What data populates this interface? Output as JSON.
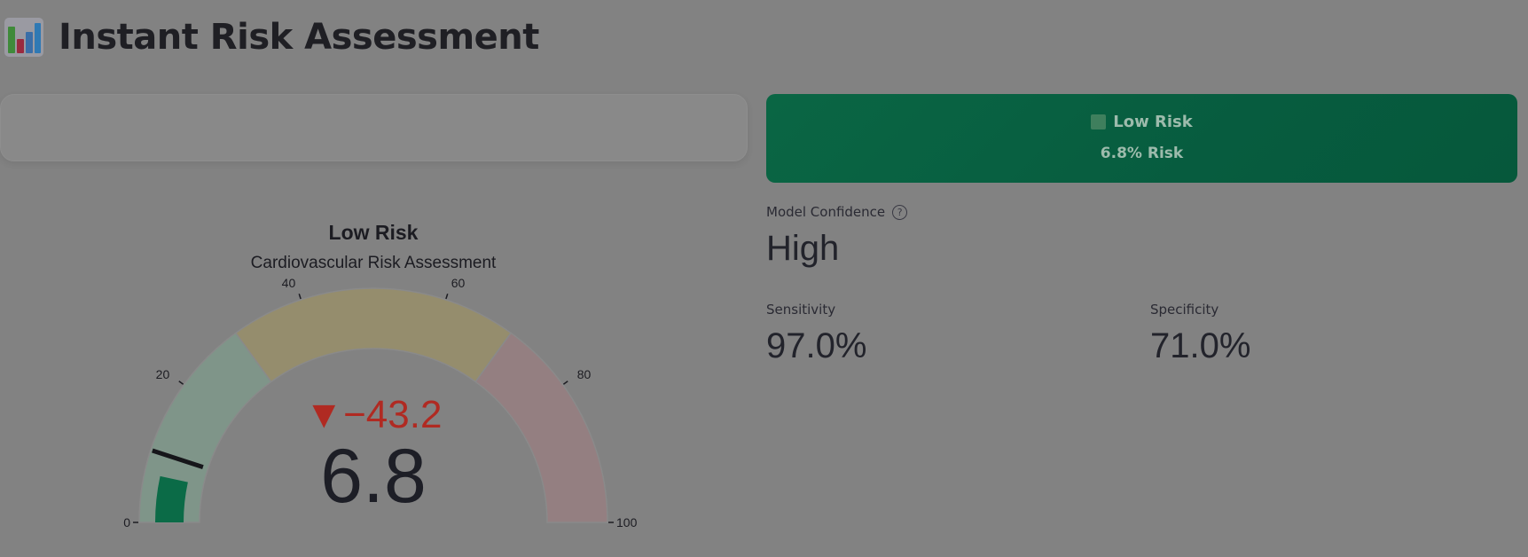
{
  "header": {
    "icon": "bar-chart-icon",
    "title": "Instant Risk Assessment"
  },
  "banner": {
    "icon": "green-square-icon",
    "label": "Low Risk",
    "risk_text": "6.8% Risk",
    "color": "#0a6644"
  },
  "metrics": {
    "confidence": {
      "label": "Model Confidence",
      "help_icon": "question-circle-icon",
      "value": "High"
    },
    "sensitivity": {
      "label": "Sensitivity",
      "value": "97.0%"
    },
    "specificity": {
      "label": "Specificity",
      "value": "71.0%"
    }
  },
  "gauge": {
    "title": "Low Risk",
    "subtitle": "Cardiovascular Risk Assessment",
    "value": 6.8,
    "value_text": "6.8",
    "delta_text": "▼−43.2",
    "delta_color": "#b02a22",
    "range": [
      0,
      100
    ],
    "tick_labels": [
      "0",
      "20",
      "40",
      "60",
      "80",
      "100"
    ],
    "ticks": [
      0,
      20,
      40,
      60,
      80,
      100
    ],
    "steps": [
      {
        "from": 0,
        "to": 30,
        "color": "#7f9589"
      },
      {
        "from": 30,
        "to": 70,
        "color": "#958d6d"
      },
      {
        "from": 70,
        "to": 100,
        "color": "#947f81"
      }
    ],
    "bar_color": "#0b6b47",
    "threshold": 10
  }
}
